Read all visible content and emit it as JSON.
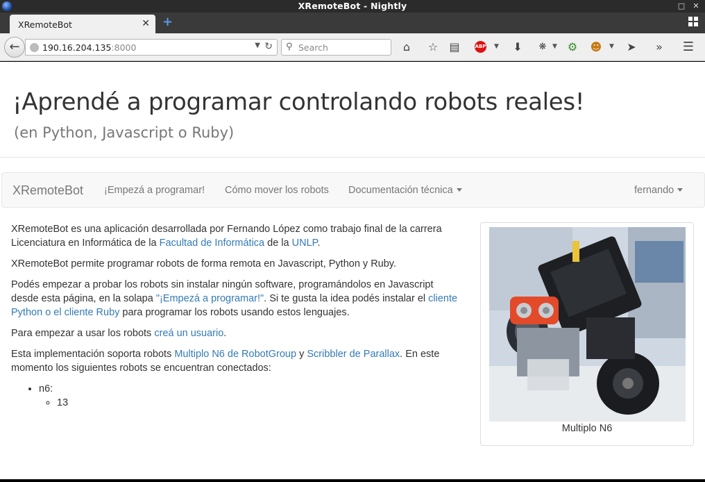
{
  "window": {
    "title": "XRemoteBot - Nightly",
    "controls": [
      "minimize",
      "close"
    ]
  },
  "tabs": [
    {
      "label": "XRemoteBot",
      "active": true
    }
  ],
  "toolbar": {
    "url_host": "190.16.204.135",
    "url_port": ":8000",
    "search_placeholder": "Search",
    "abp_label": "ABP",
    "icons": [
      "home-icon",
      "bookmark-star-icon",
      "reading-list-icon",
      "adblock-icon",
      "download-icon",
      "extension-icon",
      "extension-icon",
      "extension-icon",
      "send-icon",
      "overflow-icon",
      "hamburger-menu-icon"
    ]
  },
  "hero": {
    "title": "¡Aprendé a programar controlando robots reales!",
    "subtitle": "(en Python, Javascript o Ruby)"
  },
  "sitenav": {
    "brand": "XRemoteBot",
    "links": [
      "¡Empezá a programar!",
      "Cómo mover los robots",
      "Documentación técnica"
    ],
    "user": "fernando"
  },
  "content": {
    "p1_a": "XRemoteBot es una aplicación desarrollada por Fernando López como trabajo final de la carrera Licenciatura en Informática de la ",
    "p1_link1": "Facultad de Informática",
    "p1_b": " de la ",
    "p1_link2": "UNLP",
    "p1_c": ".",
    "p2": "XRemoteBot permite programar robots de forma remota en Javascript, Python y Ruby.",
    "p3_a": "Podés empezar a probar los robots sin instalar ningún software, programándolos en Javascript desde esta página, en la solapa ",
    "p3_link1": "\"¡Empezá a programar!\"",
    "p3_b": ". Si te gusta la idea podés instalar el ",
    "p3_link2": "cliente Python",
    "p3_c": " ",
    "p3_link3": "o el cliente Ruby",
    "p3_d": " para programar los robots usando estos lenguajes.",
    "p4_a": "Para empezar a usar los robots ",
    "p4_link": "creá un usuario",
    "p4_b": ".",
    "p5_a": "Esta implementación soporta robots ",
    "p5_link1": "Multiplo N6 de RobotGroup",
    "p5_b": " y ",
    "p5_link2": "Scribbler de Parallax",
    "p5_c": ". En este momento los siguientes robots se encuentran conectados:",
    "robot_type": "n6:",
    "robot_id": "13"
  },
  "figure": {
    "caption": "Multiplo N6"
  },
  "colors": {
    "link": "#337ab7",
    "text": "#333333",
    "nav_text": "#777777",
    "nav_bg": "#f8f8f8"
  }
}
